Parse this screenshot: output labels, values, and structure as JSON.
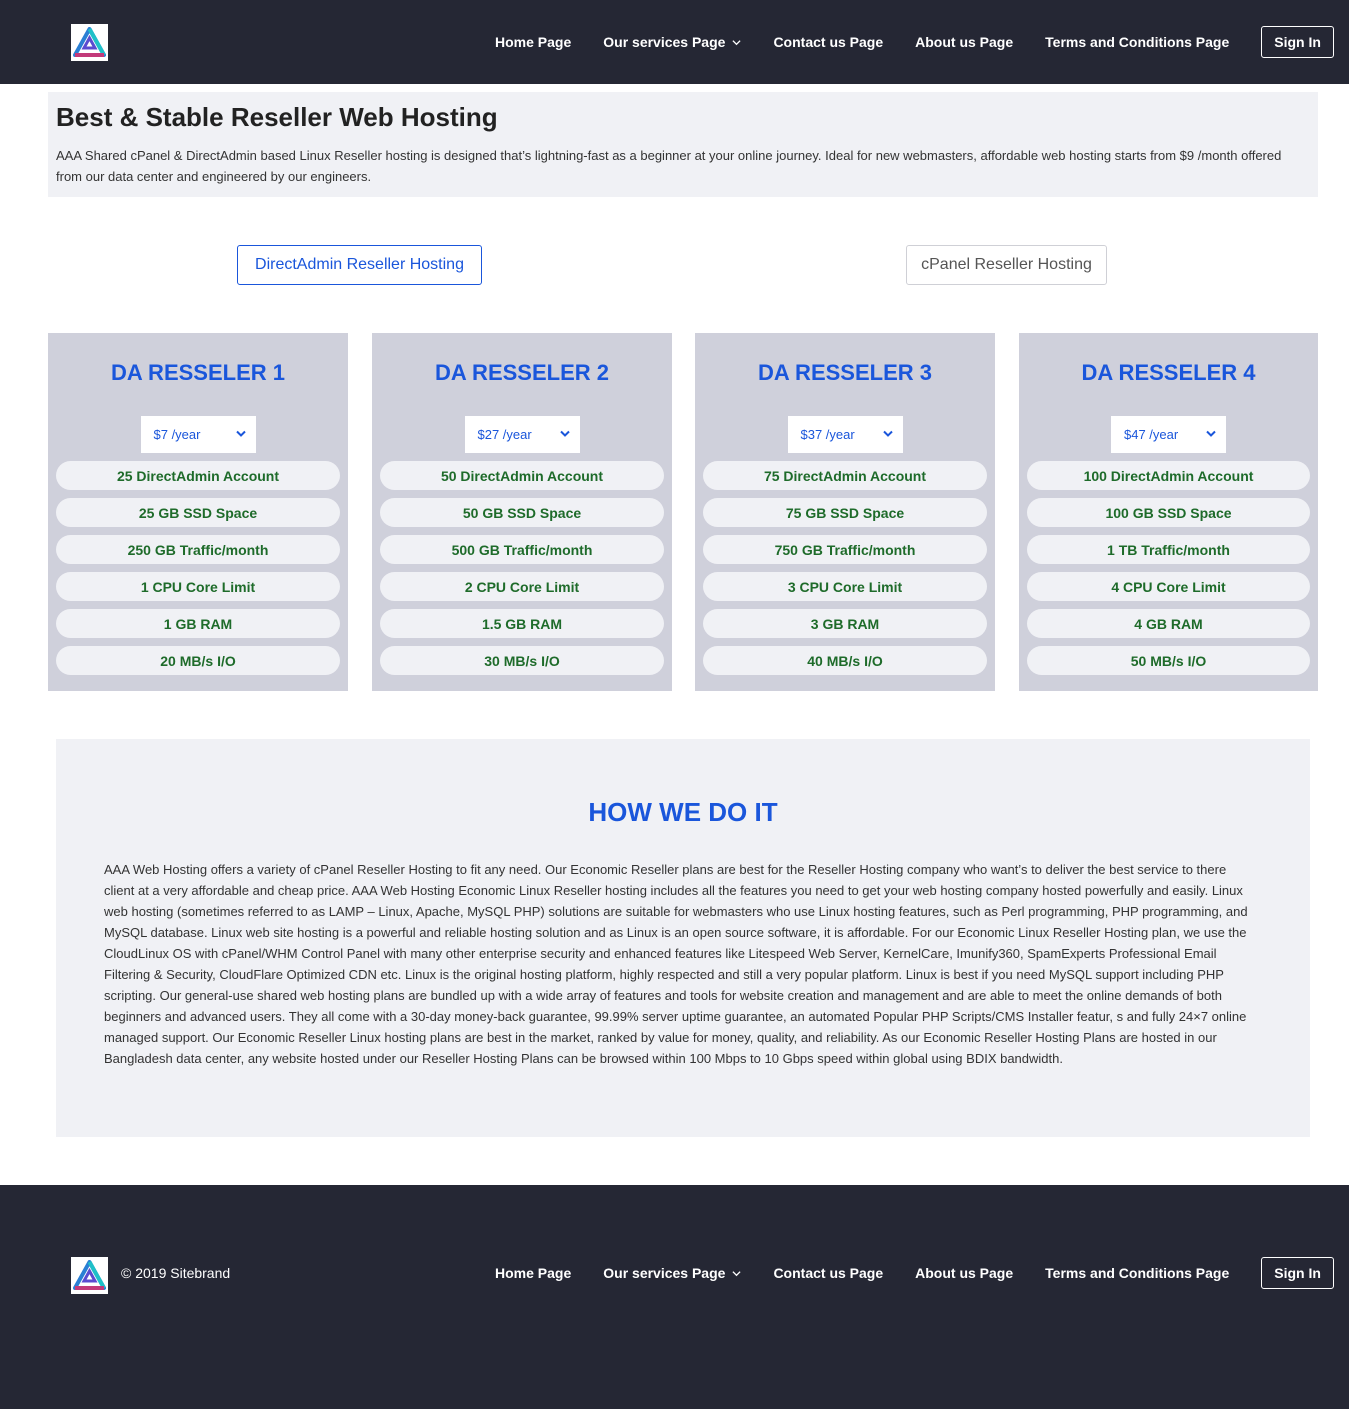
{
  "header": {
    "nav": [
      {
        "label": "Home Page"
      },
      {
        "label": "Our services Page"
      },
      {
        "label": "Contact us Page"
      },
      {
        "label": "About us Page"
      },
      {
        "label": "Terms and Conditions Page"
      }
    ],
    "signin_label": "Sign In"
  },
  "intro": {
    "title": "Best & Stable Reseller Web Hosting",
    "text": "AAA Shared cPanel & DirectAdmin based Linux Reseller hosting is designed that’s lightning-fast as a beginner at your online journey. Ideal for new webmasters, affordable web hosting starts from $9 /month offered from our data center and engineered by our engineers."
  },
  "tabs": {
    "directadmin": "DirectAdmin Reseller Hosting",
    "cpanel": "cPanel Reseller Hosting"
  },
  "plans": [
    {
      "name": "DA RESSELER 1",
      "price": "$7 /year",
      "features": [
        "25 DirectAdmin Account",
        "25 GB SSD Space",
        "250 GB Traffic/month",
        "1 CPU Core Limit",
        "1 GB RAM",
        "20 MB/s I/O"
      ]
    },
    {
      "name": "DA RESSELER 2",
      "price": "$27 /year",
      "features": [
        "50 DirectAdmin Account",
        "50 GB SSD Space",
        "500 GB Traffic/month",
        "2 CPU Core Limit",
        "1.5 GB RAM",
        "30 MB/s I/O"
      ]
    },
    {
      "name": "DA RESSELER 3",
      "price": "$37 /year",
      "features": [
        "75 DirectAdmin Account",
        "75 GB SSD Space",
        "750 GB Traffic/month",
        "3 CPU Core Limit",
        "3 GB RAM",
        "40 MB/s I/O"
      ]
    },
    {
      "name": "DA RESSELER 4",
      "price": "$47 /year",
      "features": [
        "100 DirectAdmin Account",
        "100 GB SSD Space",
        "1 TB Traffic/month",
        "4 CPU Core Limit",
        "4 GB RAM",
        "50 MB/s I/O"
      ]
    }
  ],
  "how": {
    "title": "HOW WE DO IT",
    "text": "AAA Web Hosting offers a variety of cPanel Reseller Hosting to fit any need. Our Economic Reseller plans are best for the Reseller Hosting company who want’s to deliver the best service to there client at a very affordable and cheap price. AAA Web Hosting Economic Linux Reseller hosting includes all the features you need to get your web hosting company hosted powerfully and easily. Linux web hosting (sometimes referred to as LAMP – Linux, Apache, MySQL PHP) solutions are suitable for webmasters who use Linux hosting features, such as Perl programming, PHP programming, and MySQL database. Linux web site hosting is a powerful and reliable hosting solution and as Linux is an open source software, it is affordable. For our Economic Linux Reseller Hosting plan, we use the CloudLinux OS with cPanel/WHM Control Panel with many other enterprise security and enhanced features like Litespeed Web Server, KernelCare, Imunify360, SpamExperts Professional Email Filtering & Security, CloudFlare Optimized CDN etc. Linux is the original hosting platform, highly respected and still a very popular platform. Linux is best if you need MySQL support including PHP scripting. Our general-use shared web hosting plans are bundled up with a wide array of features and tools for website creation and management and are able to meet the online demands of both beginners and advanced users. They all come with a 30-day money-back guarantee, 99.99% server uptime guarantee, an automated Popular PHP Scripts/CMS Installer featur, s and fully 24×7 online managed support. Our Economic Reseller Linux hosting plans are best in the market, ranked by value for money, quality, and reliability. As our Economic Reseller Hosting Plans are hosted in our Bangladesh data center, any website hosted under our Reseller Hosting Plans can be browsed within 100 Mbps to 10 Gbps speed within global using BDIX bandwidth."
  },
  "footer": {
    "copyright": "© 2019 Sitebrand"
  },
  "icons": {
    "logo": "logo-icon",
    "dropdown": "chevron-down-icon"
  },
  "colors": {
    "dark": "#252734",
    "accent": "#1a56db",
    "feature_text": "#1e6b2a",
    "card_bg": "#cfd0db",
    "panel_bg": "#f0f1f5"
  }
}
